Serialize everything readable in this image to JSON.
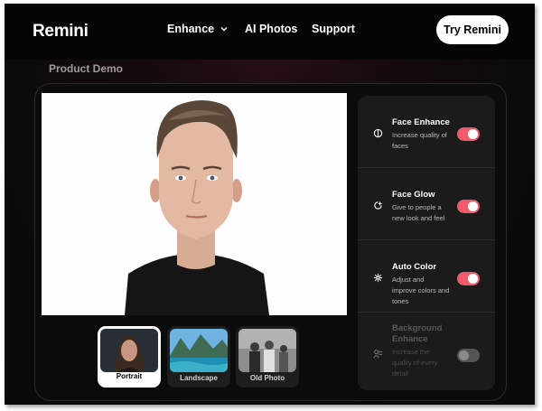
{
  "brand": {
    "name": "Remini"
  },
  "nav": {
    "items": [
      {
        "label": "Enhance",
        "has_dropdown": true
      },
      {
        "label": "AI Photos"
      },
      {
        "label": "Support"
      }
    ],
    "cta": "Try Remini"
  },
  "demo": {
    "section_title": "Product Demo",
    "thumbnails": [
      {
        "label": "Portrait",
        "selected": true
      },
      {
        "label": "Landscape",
        "selected": false
      },
      {
        "label": "Old Photo",
        "selected": false
      }
    ],
    "features": [
      {
        "title": "Face Enhance",
        "desc": "Increase quality of faces",
        "icon": "face-icon",
        "enabled": true
      },
      {
        "title": "Face Glow",
        "desc": "Give to people a new look and feel",
        "icon": "glow-icon",
        "enabled": true
      },
      {
        "title": "Auto Color",
        "desc": "Adjust and improve colors and tones",
        "icon": "color-icon",
        "enabled": true
      },
      {
        "title": "Background Enhance",
        "desc": "Increase the quality of every detail",
        "icon": "background-icon",
        "enabled": false
      }
    ]
  },
  "colors": {
    "accent": "#f25a70",
    "background": "#0b0b0c",
    "panel": "#1b1b1b"
  }
}
